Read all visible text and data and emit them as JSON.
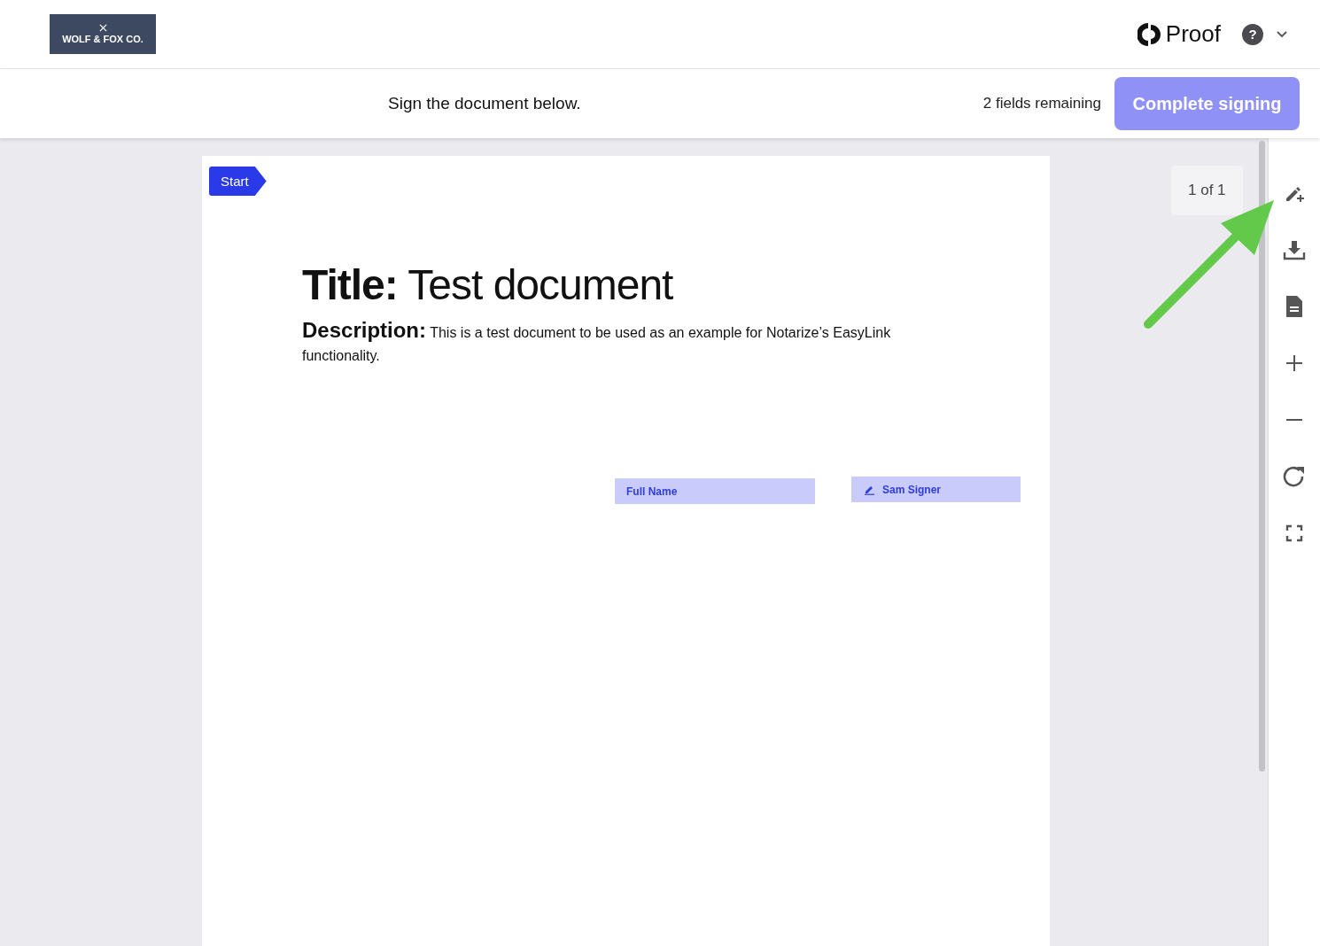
{
  "header": {
    "logo": {
      "name": "WOLF & FOX CO."
    },
    "brand": "Proof",
    "help_icon": "?"
  },
  "action_bar": {
    "instruction": "Sign the document below.",
    "fields_remaining": "2 fields remaining",
    "complete_button": "Complete signing"
  },
  "document": {
    "start_tag": "Start",
    "page_counter": "1 of 1",
    "title_label": "Title:",
    "title": "Test document",
    "description_label": "Description:",
    "description": "This is a test document to be used as an example for Notarize’s EasyLink functionality.",
    "fields": [
      {
        "kind": "text",
        "label": "Full Name"
      },
      {
        "kind": "signature",
        "label": "Sam Signer"
      }
    ]
  },
  "toolbar": [
    {
      "kind": "annotate"
    },
    {
      "kind": "download"
    },
    {
      "kind": "document"
    },
    {
      "kind": "zoom-in"
    },
    {
      "kind": "zoom-out"
    },
    {
      "kind": "rotate"
    },
    {
      "kind": "fullscreen"
    }
  ]
}
